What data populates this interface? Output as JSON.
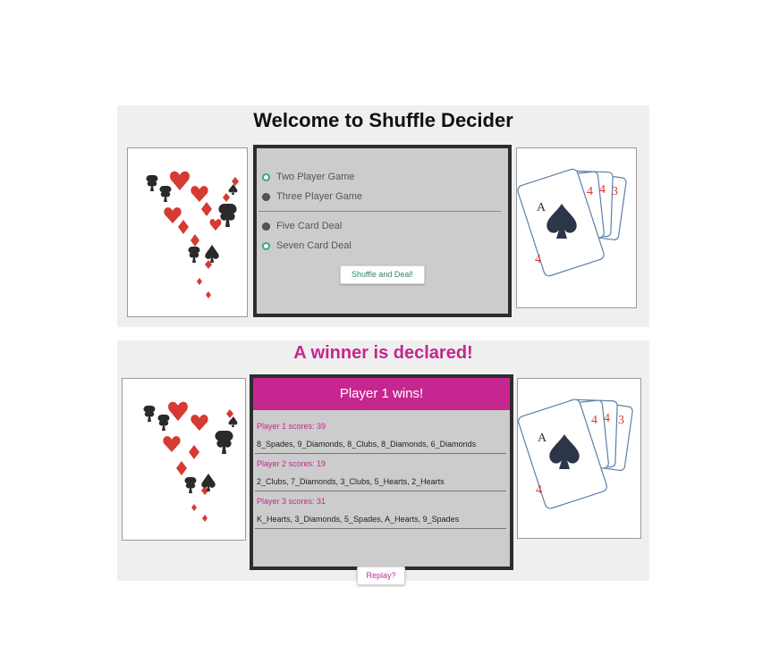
{
  "welcome": {
    "title": "Welcome to Shuffle Decider",
    "players": [
      {
        "label": "Two Player Game",
        "selected": true
      },
      {
        "label": "Three Player Game",
        "selected": false
      }
    ],
    "deals": [
      {
        "label": "Five Card Deal",
        "selected": false
      },
      {
        "label": "Seven Card Deal",
        "selected": true
      }
    ],
    "button": "Shuffle and Deal!"
  },
  "result": {
    "title": "A winner is declared!",
    "winner": "Player 1 wins!",
    "players": [
      {
        "score": "Player 1 scores: 39",
        "hand": "8_Spades, 9_Diamonds, 8_Clubs, 8_Diamonds, 6_Diamonds"
      },
      {
        "score": "Player 2 scores: 19",
        "hand": "2_Clubs, 7_Diamonds, 3_Clubs, 5_Hearts, 2_Hearts"
      },
      {
        "score": "Player 3 scores: 31",
        "hand": "K_Hearts, 3_Diamonds, 5_Spades, A_Hearts, 9_Spades"
      }
    ],
    "button": "Replay?"
  },
  "colors": {
    "accent": "#c6268f",
    "radio_on": "#3aa874",
    "panel_bg": "#efefef",
    "box_bg": "#cccccc"
  },
  "images": [
    "card-suits-burst-image",
    "playing-cards-fan-image"
  ]
}
